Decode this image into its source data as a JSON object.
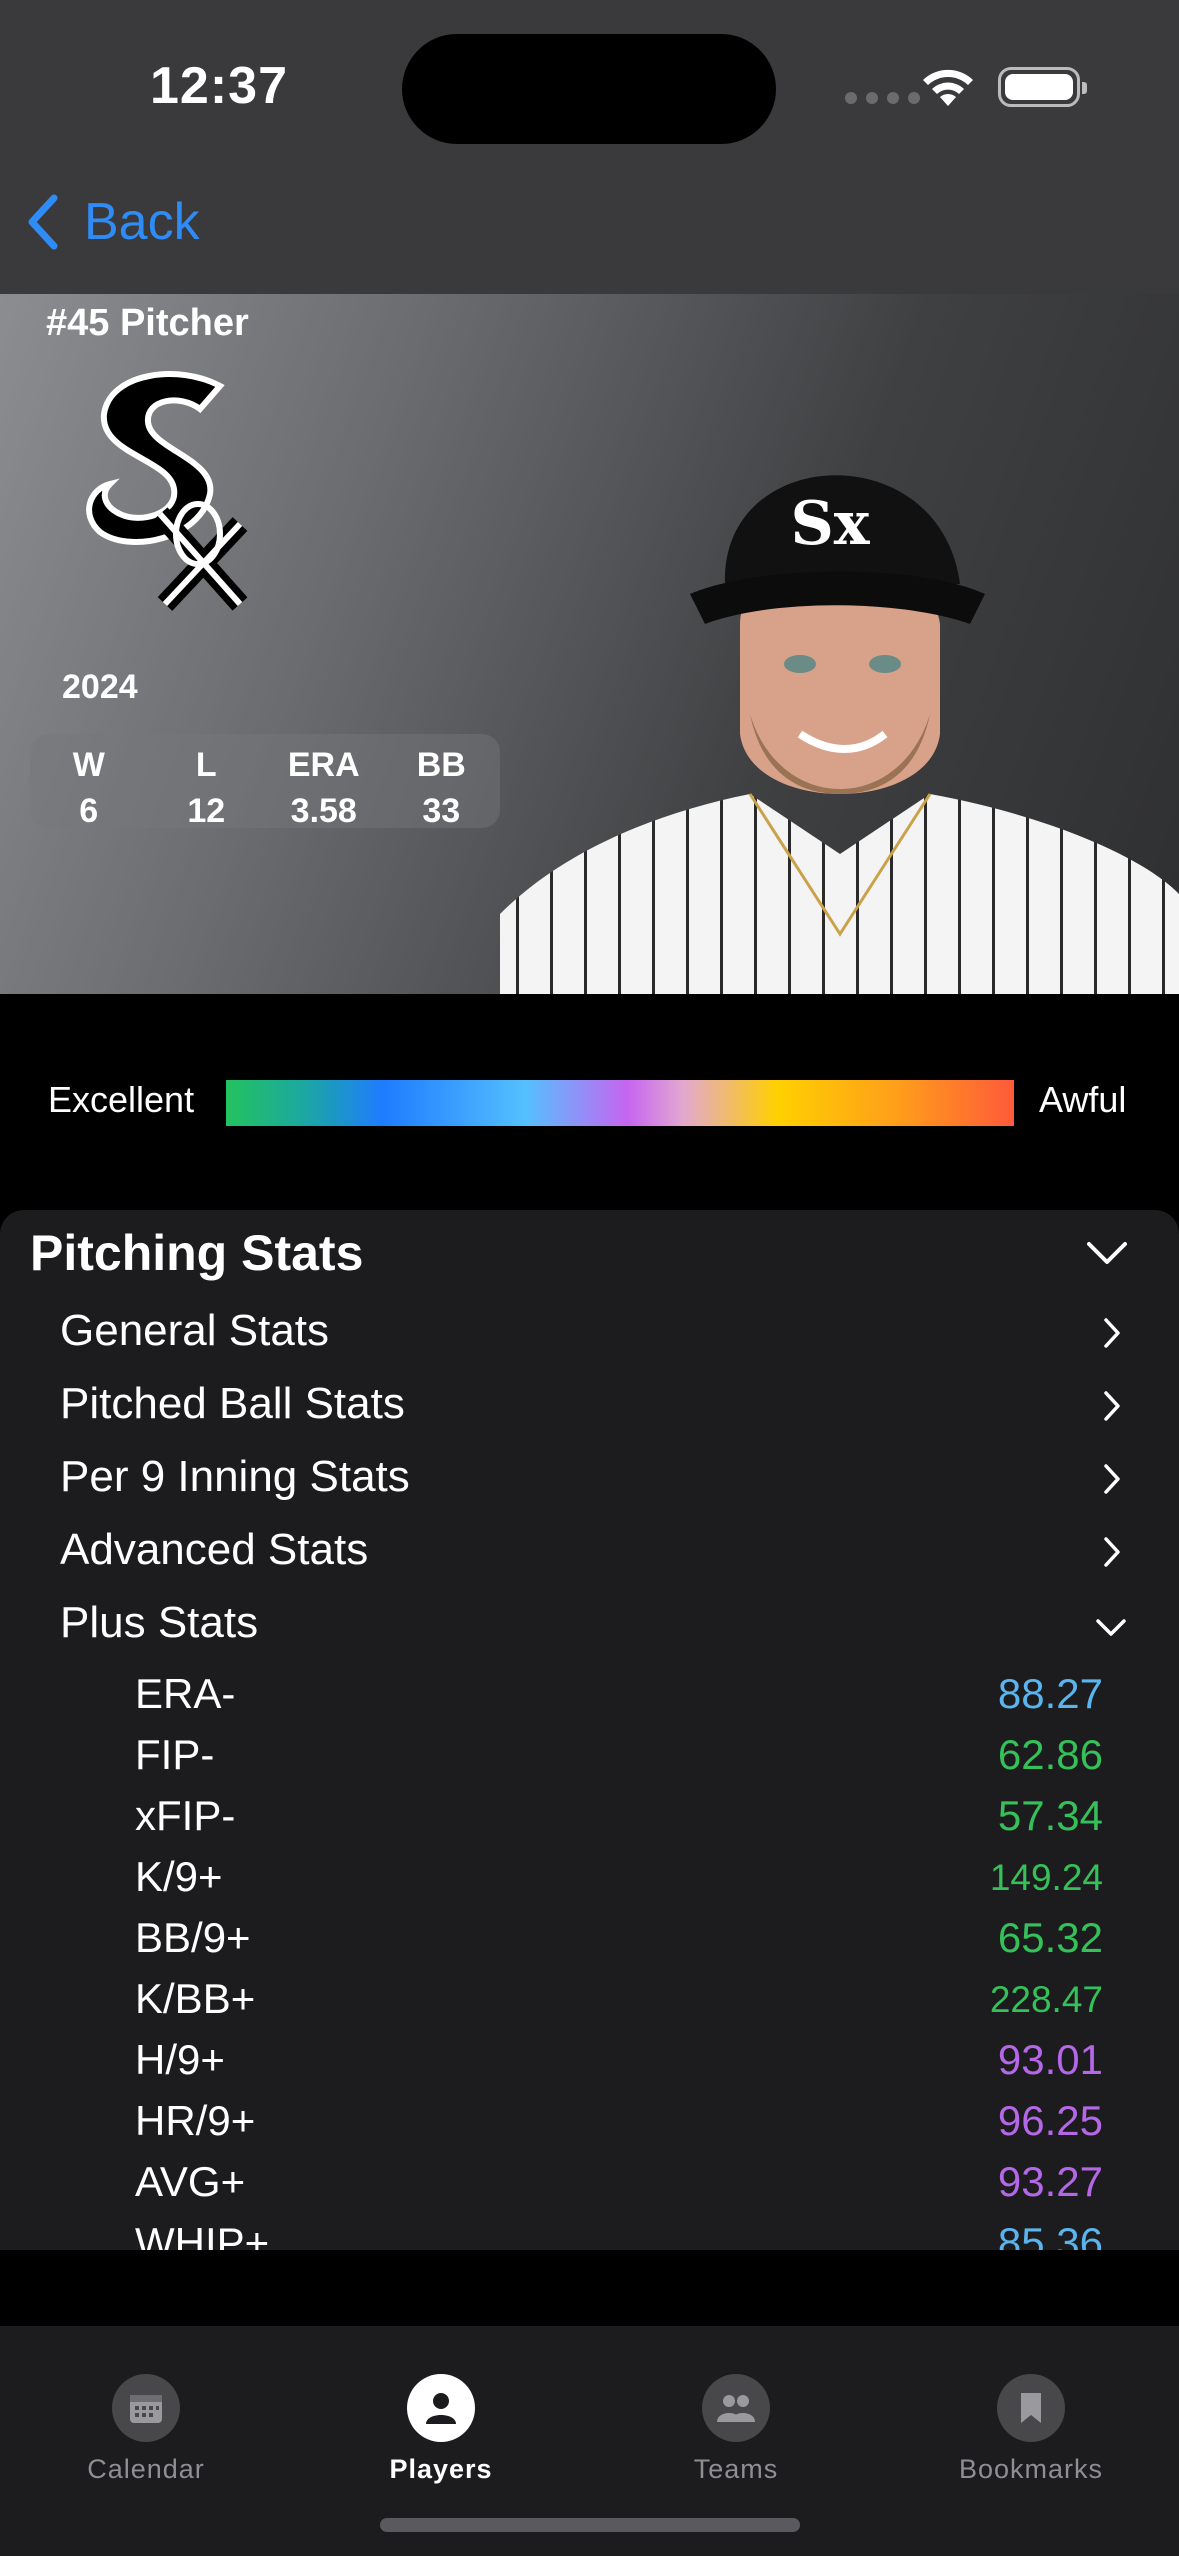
{
  "status_bar": {
    "time": "12:37"
  },
  "nav": {
    "back_label": "Back"
  },
  "player": {
    "jersey_position": "#45 Pitcher",
    "season": "2024",
    "season_stats": [
      {
        "label": "W",
        "value": "6"
      },
      {
        "label": "L",
        "value": "12"
      },
      {
        "label": "ERA",
        "value": "3.58"
      },
      {
        "label": "BB",
        "value": "33"
      }
    ]
  },
  "legend": {
    "left_label": "Excellent",
    "right_label": "Awful"
  },
  "pitching": {
    "title": "Pitching Stats",
    "categories": [
      {
        "label": "General Stats"
      },
      {
        "label": "Pitched Ball Stats"
      },
      {
        "label": "Per 9 Inning Stats"
      },
      {
        "label": "Advanced Stats"
      },
      {
        "label": "Plus Stats"
      }
    ],
    "plus_stats": [
      {
        "name": "ERA-",
        "value": "88.27",
        "color": "#5ab4ee"
      },
      {
        "name": "FIP-",
        "value": "62.86",
        "color": "#35c159"
      },
      {
        "name": "xFIP-",
        "value": "57.34",
        "color": "#35c159"
      },
      {
        "name": "K/9+",
        "value": "149.24",
        "color": "#35c159"
      },
      {
        "name": "BB/9+",
        "value": "65.32",
        "color": "#35c159"
      },
      {
        "name": "K/BB+",
        "value": "228.47",
        "color": "#35c159"
      },
      {
        "name": "H/9+",
        "value": "93.01",
        "color": "#b467e6"
      },
      {
        "name": "HR/9+",
        "value": "96.25",
        "color": "#b467e6"
      },
      {
        "name": "AVG+",
        "value": "93.27",
        "color": "#b467e6"
      },
      {
        "name": "WHIP+",
        "value": "85.36",
        "color": "#5ab4ee"
      }
    ]
  },
  "tabs": [
    {
      "label": "Calendar",
      "icon": "calendar-icon"
    },
    {
      "label": "Players",
      "icon": "person-icon"
    },
    {
      "label": "Teams",
      "icon": "people-icon"
    },
    {
      "label": "Bookmarks",
      "icon": "bookmark-icon"
    }
  ]
}
